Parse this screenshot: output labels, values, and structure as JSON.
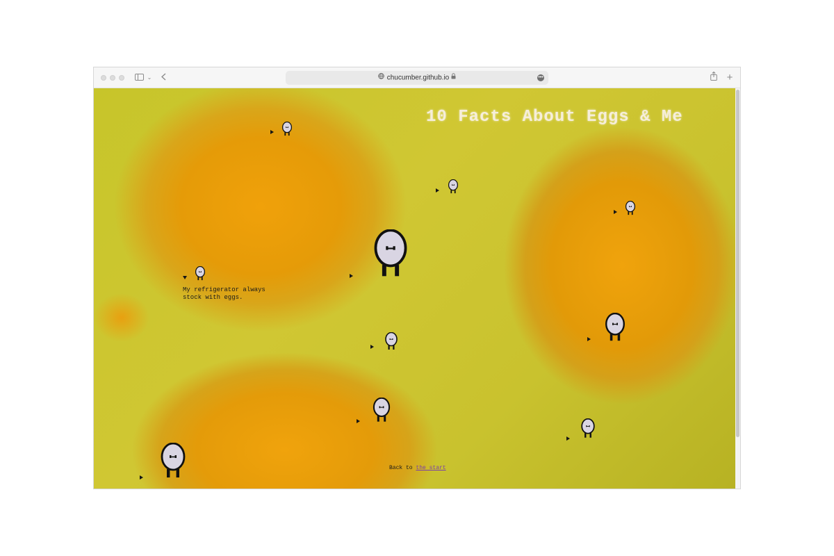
{
  "browser": {
    "url": "chucumber.github.io"
  },
  "page": {
    "title": "10 Facts About Eggs & Me",
    "open_fact_text": "My refrigerator always stock with eggs.",
    "back_prefix": "Back to",
    "back_link": "the start"
  },
  "icons": {
    "sidebar": "sidebar-icon",
    "back": "chevron-left-icon",
    "share": "share-icon",
    "new_tab": "plus-icon",
    "fact_character": "egg-character-icon",
    "disclosure": "triangle-icon"
  }
}
